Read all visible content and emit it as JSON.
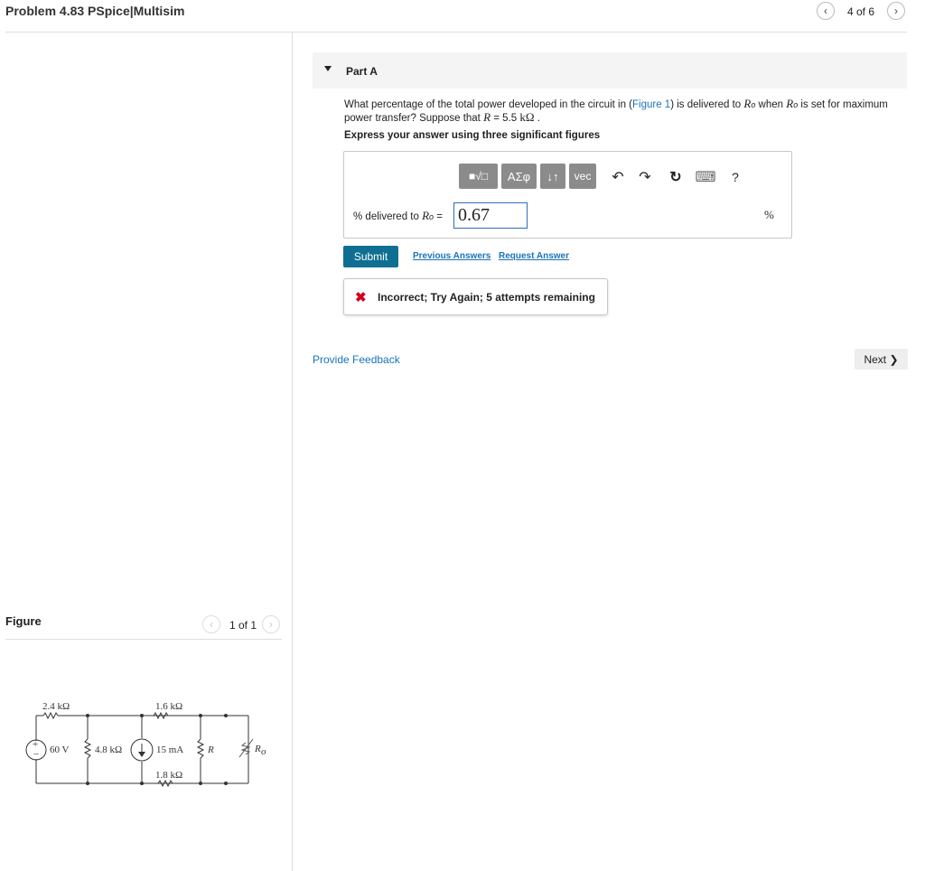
{
  "header": {
    "title": "Problem 4.83 PSpice|Multisim",
    "nav": {
      "prev_icon": "‹",
      "position": "4 of 6",
      "next_icon": "›"
    }
  },
  "part": {
    "label": "Part A"
  },
  "question": {
    "text_1": "What percentage of the total power developed in the circuit in (",
    "figure_link": "Figure 1",
    "text_2": ") is delivered to ",
    "var_R": "R",
    "sub_o": "o",
    "text_3": " when ",
    "text_4": " is set for maximum power transfer? Suppose that ",
    "text_5": " = 5.5 ",
    "unit_kohm": "kΩ",
    "text_6": " .",
    "instruction": "Express your answer using three significant figures"
  },
  "toolbar": {
    "template_icon": "■√□",
    "greek": "ΑΣφ",
    "updown": "↓↑",
    "vec": "vec",
    "undo_icon": "↶",
    "redo_icon": "↷",
    "reset_icon": "↻",
    "keyboard_icon": "⌨",
    "help": "?"
  },
  "answer": {
    "label_prefix": "% delivered to ",
    "label_var": "R",
    "label_sub": "o",
    "label_eq": " =",
    "value": "0.67",
    "unit": "%"
  },
  "actions": {
    "submit": "Submit",
    "previous_answers": "Previous Answers",
    "request_answer": "Request Answer"
  },
  "feedback": {
    "icon": "✖",
    "text": "Incorrect; Try Again; 5 attempts remaining"
  },
  "footer": {
    "provide_feedback": "Provide Feedback",
    "next": "Next ❯"
  },
  "figure": {
    "label": "Figure",
    "position": "1 of 1",
    "prev_icon": "‹",
    "next_icon": "›",
    "circuit": {
      "r1": "2.4 kΩ",
      "r2": "1.6 kΩ",
      "r3": "4.8 kΩ",
      "r4": "1.8 kΩ",
      "source_v": "60 V",
      "source_i": "15 mA",
      "plus": "+",
      "minus": "−",
      "r_var": "R",
      "ro": "R",
      "ro_sub": "o"
    }
  },
  "colors": {
    "accent": "#0f6f93",
    "link": "#1a73b8",
    "error": "#d0021b",
    "toolbar": "#8b8b8b"
  }
}
